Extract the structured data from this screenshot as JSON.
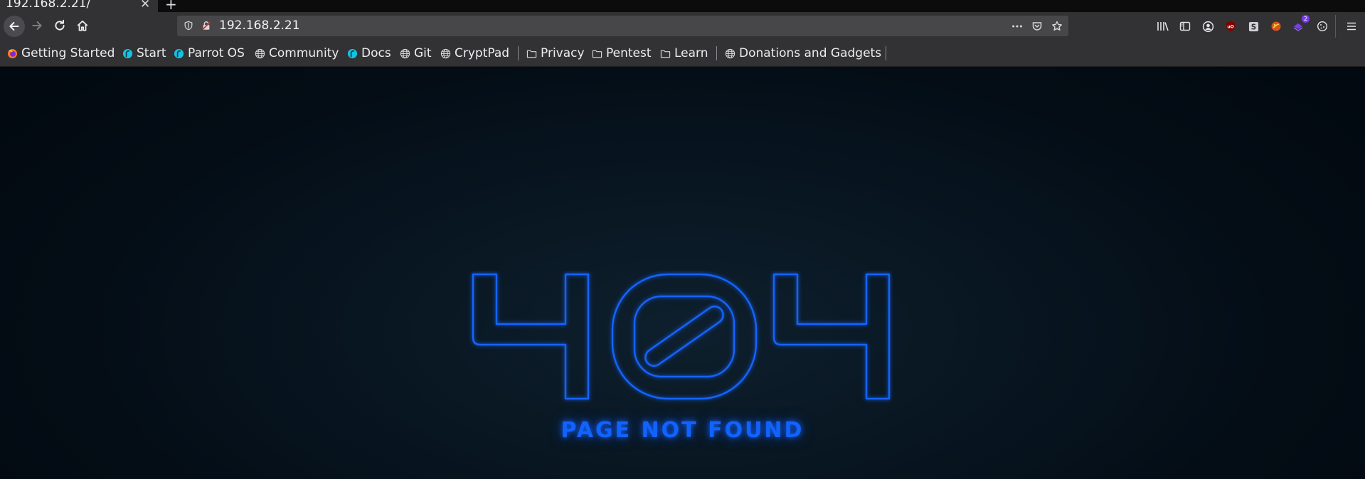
{
  "tab": {
    "title": "192.168.2.21/",
    "close_icon": "close-icon",
    "new_tab_icon": "plus-icon"
  },
  "navbar": {
    "url": "192.168.2.21",
    "icons": [
      "back-icon",
      "forward-icon",
      "reload-icon",
      "home-icon",
      "tracking-shield-icon",
      "insecure-lock-icon",
      "page-actions-icon",
      "pocket-icon",
      "bookmark-star-icon",
      "library-icon",
      "sidebar-icon",
      "account-icon",
      "ublock-icon",
      "extension-s-icon",
      "extension-orange-icon",
      "extension-purple-icon",
      "cookie-icon",
      "menu-icon"
    ],
    "badge_count": "2"
  },
  "bookmarks": [
    {
      "label": "Getting Started",
      "icon": "firefox-icon"
    },
    {
      "label": "Start",
      "icon": "parrot-icon"
    },
    {
      "label": "Parrot OS",
      "icon": "parrot-icon"
    },
    {
      "label": "Community",
      "icon": "globe-icon"
    },
    {
      "label": "Docs",
      "icon": "parrot-icon"
    },
    {
      "label": "Git",
      "icon": "globe-icon"
    },
    {
      "label": "CryptPad",
      "icon": "globe-icon"
    },
    {
      "label": "Privacy",
      "icon": "folder-icon"
    },
    {
      "label": "Pentest",
      "icon": "folder-icon"
    },
    {
      "label": "Learn",
      "icon": "folder-icon"
    },
    {
      "label": "Donations and Gadgets",
      "icon": "globe-icon"
    }
  ],
  "content": {
    "heading": "404",
    "message": "PAGE NOT FOUND",
    "accent_color": "#1163ff",
    "background_color": "#040d16"
  }
}
